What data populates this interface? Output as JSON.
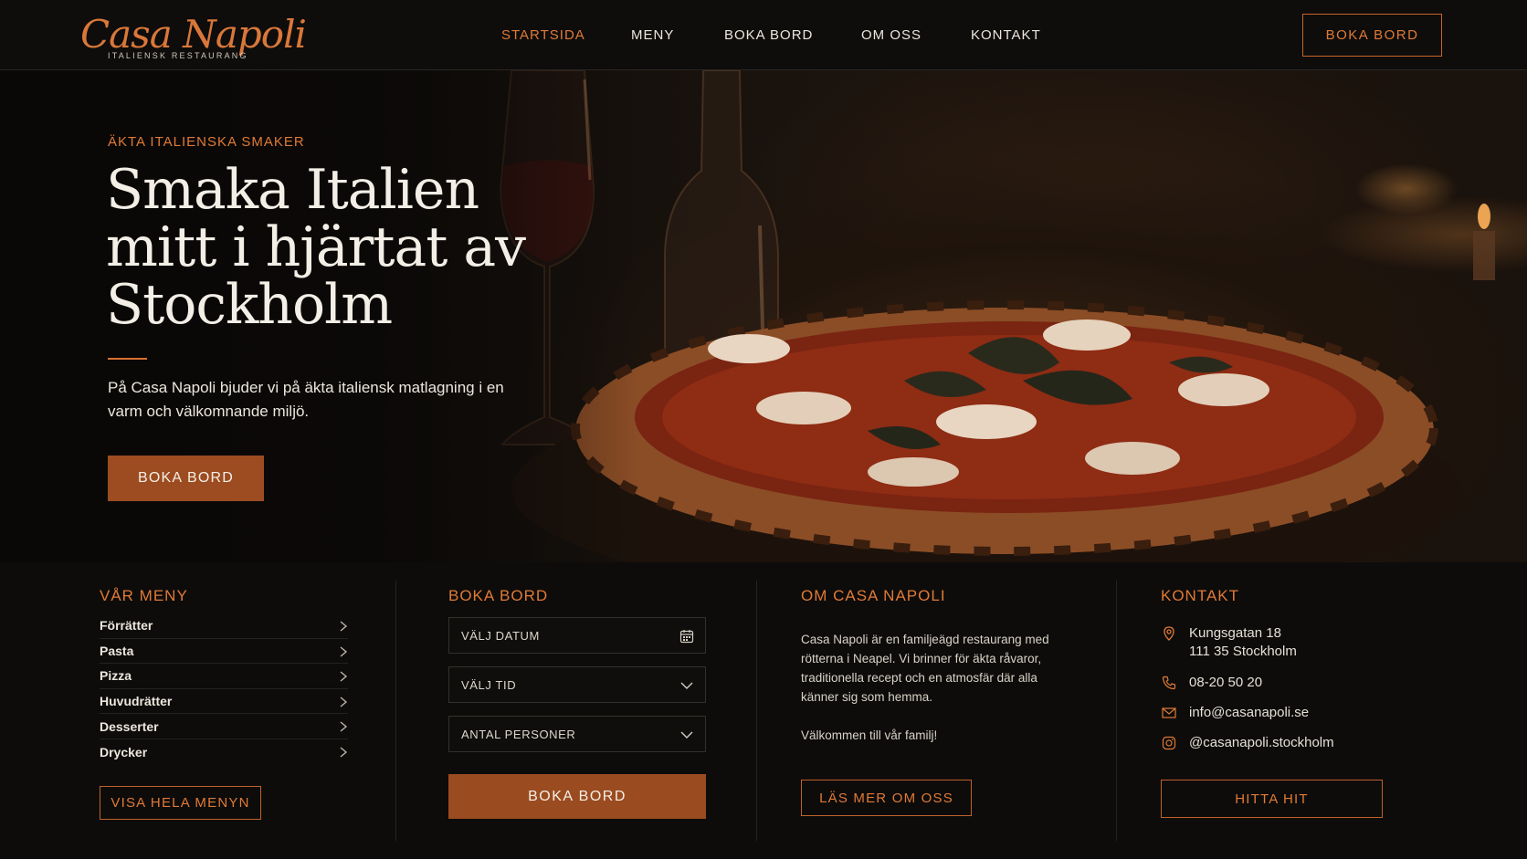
{
  "brand": {
    "name": "Casa Napoli",
    "tagline": "ITALIENSK RESTAURANG",
    "accent_color": "#e07a36"
  },
  "nav": {
    "items": [
      {
        "label": "STARTSIDA",
        "active": true
      },
      {
        "label": "MENY",
        "active": false
      },
      {
        "label": "BOKA BORD",
        "active": false
      },
      {
        "label": "OM OSS",
        "active": false
      },
      {
        "label": "KONTAKT",
        "active": false
      }
    ],
    "cta_label": "BOKA BORD"
  },
  "hero": {
    "kicker": "ÄKTA ITALIENSKA SMAKER",
    "title": "Smaka Italien mitt i hjärtat av Stockholm",
    "text": "På Casa Napoli bjuder vi på äkta italiensk matlagning i en varm och välkomnande miljö.",
    "button_label": "BOKA BORD"
  },
  "menu_panel": {
    "title": "VÅR MENY",
    "items": [
      "Förrätter",
      "Pasta",
      "Pizza",
      "Huvudrätter",
      "Desserter",
      "Drycker"
    ],
    "button_label": "VISA HELA MENYN"
  },
  "booking_panel": {
    "title": "BOKA BORD",
    "date_placeholder": "VÄLJ DATUM",
    "time_placeholder": "VÄLJ TID",
    "persons_placeholder": "ANTAL PERSONER",
    "button_label": "BOKA BORD"
  },
  "about_panel": {
    "title": "OM CASA NAPOLI",
    "text": "Casa Napoli är en familjeägd restaurang med rötterna i Neapel. Vi brinner för äkta råvaror, traditionella recept och en atmosfär där alla känner sig som hemma.",
    "welcome": "Välkommen till vår familj!",
    "button_label": "LÄS MER OM OSS"
  },
  "contact_panel": {
    "title": "KONTAKT",
    "address_line1": "Kungsgatan 18",
    "address_line2": "111 35 Stockholm",
    "phone": "08-20 50 20",
    "email": "info@casanapoli.se",
    "instagram": "@casanapoli.stockholm",
    "button_label": "HITTA HIT"
  }
}
